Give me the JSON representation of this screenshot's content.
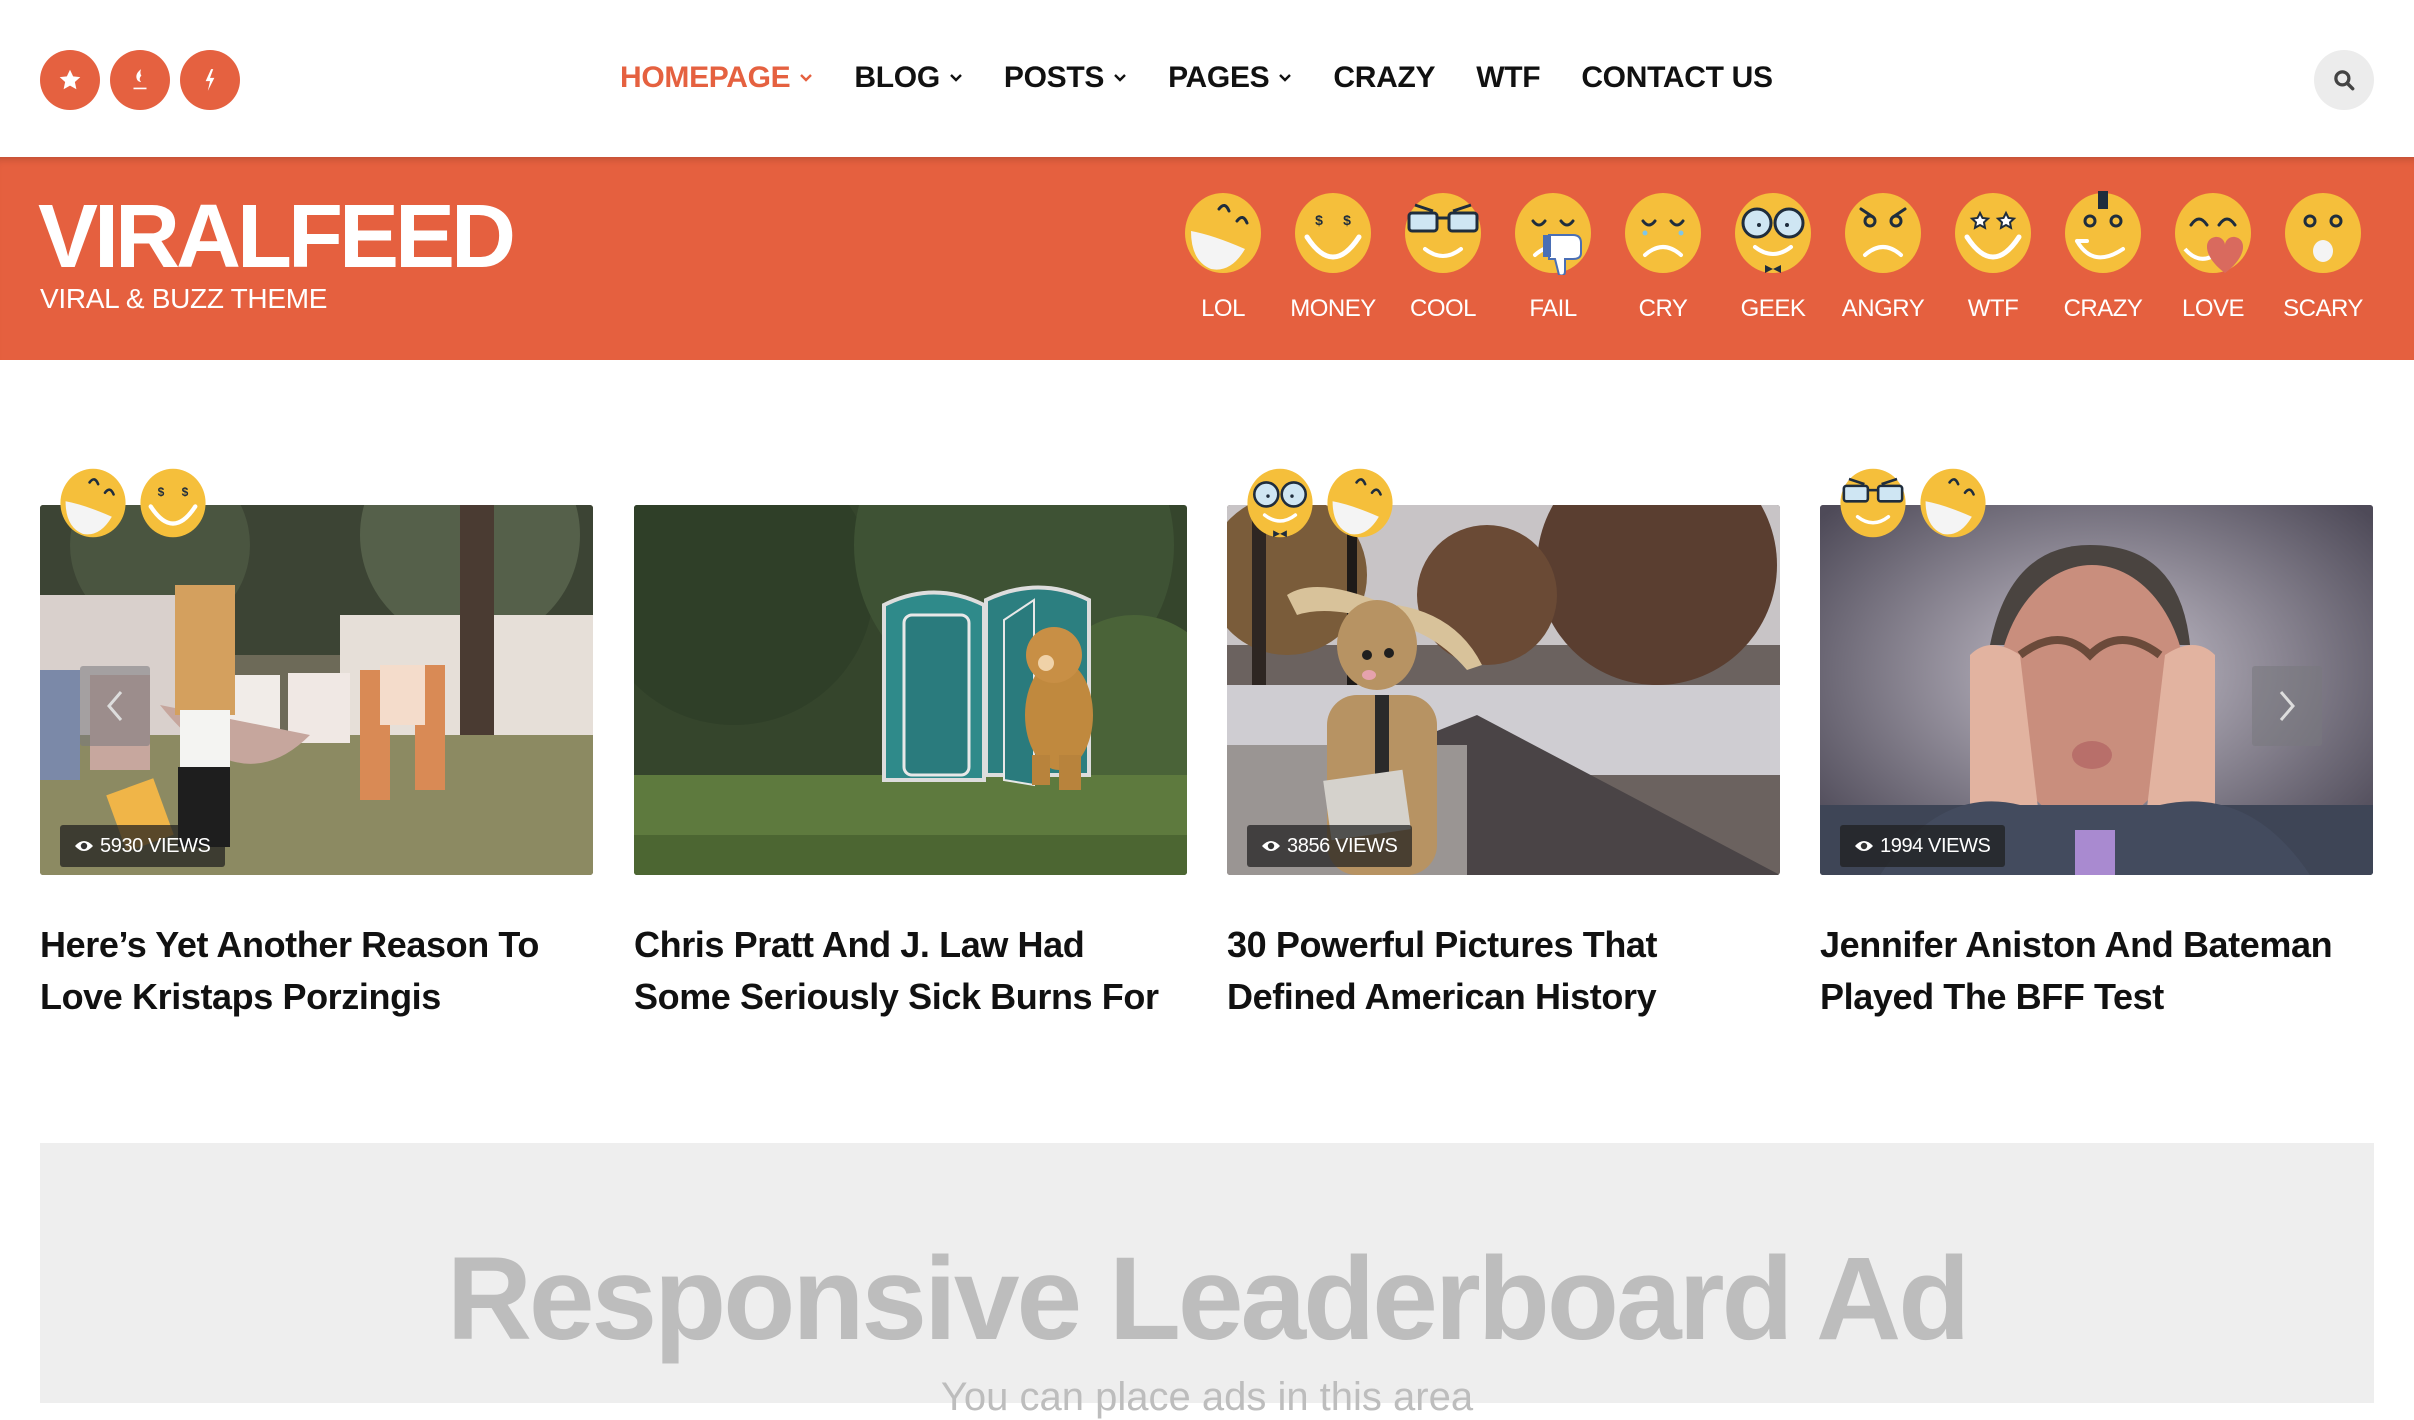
{
  "theme": {
    "accent": "#e5603f",
    "face_yellow": "#f5bf3b",
    "text_dark": "#111111",
    "ad_bg": "#eeeeee",
    "ad_text": "#bdbdbd"
  },
  "header": {
    "social_icons": [
      {
        "name": "star-icon"
      },
      {
        "name": "flame-icon"
      },
      {
        "name": "lightning-icon"
      }
    ],
    "nav": [
      {
        "label": "HOMEPAGE",
        "active": true,
        "dropdown": true
      },
      {
        "label": "BLOG",
        "active": false,
        "dropdown": true
      },
      {
        "label": "POSTS",
        "active": false,
        "dropdown": true
      },
      {
        "label": "PAGES",
        "active": false,
        "dropdown": true
      },
      {
        "label": "CRAZY",
        "active": false,
        "dropdown": false
      },
      {
        "label": "WTF",
        "active": false,
        "dropdown": false
      },
      {
        "label": "CONTACT US",
        "active": false,
        "dropdown": false
      }
    ],
    "search_icon": "search-icon"
  },
  "brand": {
    "title": "VIRALFEED",
    "tagline": "VIRAL & BUZZ THEME"
  },
  "reactions": [
    {
      "key": "lol",
      "label": "LOL"
    },
    {
      "key": "money",
      "label": "MONEY"
    },
    {
      "key": "cool",
      "label": "COOL"
    },
    {
      "key": "fail",
      "label": "FAIL"
    },
    {
      "key": "cry",
      "label": "CRY"
    },
    {
      "key": "geek",
      "label": "GEEK"
    },
    {
      "key": "angry",
      "label": "ANGRY"
    },
    {
      "key": "wtf",
      "label": "WTF"
    },
    {
      "key": "crazy",
      "label": "CRAZY"
    },
    {
      "key": "love",
      "label": "LOVE"
    },
    {
      "key": "scary",
      "label": "SCARY"
    }
  ],
  "posts": [
    {
      "title": "Here’s Yet Another Reason To Love Kristaps Porzingis",
      "views": "5930 VIEWS",
      "badges": [
        "lol",
        "money"
      ],
      "image": "man in bunny suit hanging laundry"
    },
    {
      "title": "Chris Pratt And J. Law Had Some Seriously Sick Burns For",
      "views": null,
      "badges": [],
      "image": "teddy bear by portable toilets"
    },
    {
      "title": "30 Powerful Pictures That Defined American History",
      "views": "3856 VIEWS",
      "badges": [
        "geek",
        "lol"
      ],
      "image": "bunny costume reading newspaper"
    },
    {
      "title": "Jennifer Aniston And Bateman Played The BFF Test",
      "views": "1994 VIEWS",
      "badges": [
        "cool",
        "lol"
      ],
      "image": "man squishing face with hands"
    }
  ],
  "carousel": {
    "prev_icon": "chevron-left-icon",
    "next_icon": "chevron-right-icon"
  },
  "ad": {
    "title": "Responsive Leaderboard Ad",
    "subtitle": "You can place ads in this area"
  }
}
